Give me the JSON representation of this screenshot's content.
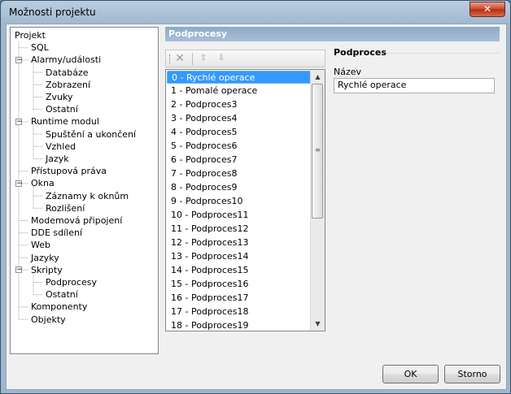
{
  "window": {
    "title": "Možnosti projektu",
    "close_glyph": "✕"
  },
  "tree": {
    "items": [
      {
        "label": "Projekt"
      },
      {
        "label": "SQL"
      },
      {
        "label": "Alarmy/události"
      },
      {
        "label": "Databáze"
      },
      {
        "label": "Zobrazení"
      },
      {
        "label": "Zvuky"
      },
      {
        "label": "Ostatní"
      },
      {
        "label": "Runtime modul"
      },
      {
        "label": "Spuštění a ukončení"
      },
      {
        "label": "Vzhled"
      },
      {
        "label": "Jazyk"
      },
      {
        "label": "Přístupová práva"
      },
      {
        "label": "Okna"
      },
      {
        "label": "Záznamy k oknům"
      },
      {
        "label": "Rozlišení"
      },
      {
        "label": "Modemová připojení"
      },
      {
        "label": "DDE sdílení"
      },
      {
        "label": "Web"
      },
      {
        "label": "Jazyky"
      },
      {
        "label": "Skripty"
      },
      {
        "label": "Podprocesy"
      },
      {
        "label": "Ostatní"
      },
      {
        "label": "Komponenty"
      },
      {
        "label": "Objekty"
      }
    ]
  },
  "panel": {
    "title": "Podprocesy"
  },
  "list": {
    "selected_index": 0,
    "items": [
      "0 - Rychlé operace",
      "1 - Pomalé operace",
      "2 - Podproces3",
      "3 - Podproces4",
      "4 - Podproces5",
      "5 - Podproces6",
      "6 - Podproces7",
      "7 - Podproces8",
      "8 - Podproces9",
      "9 - Podproces10",
      "10 - Podproces11",
      "11 - Podproces12",
      "12 - Podproces13",
      "13 - Podproces14",
      "14 - Podproces15",
      "15 - Podproces16",
      "16 - Podproces17",
      "17 - Podproces18",
      "18 - Podproces19"
    ]
  },
  "properties": {
    "section_title": "Podproces",
    "name_label": "Název",
    "name_value": "Rychlé operace"
  },
  "buttons": {
    "ok": "OK",
    "cancel": "Storno"
  }
}
